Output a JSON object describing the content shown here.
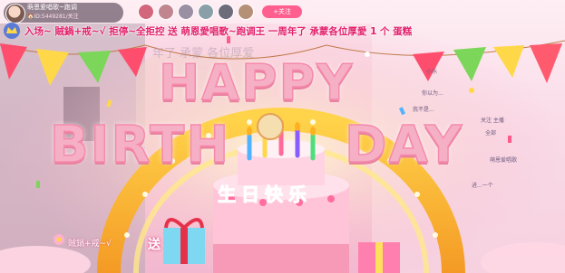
{
  "host": {
    "name": "萌恩爱唱歌~跑调",
    "id_line": "🏠ID:5449281/关注"
  },
  "follow_label": "+关注",
  "marquee": {
    "text": "入场~ 賊鍋+戒~√ 拒停~全拒控 送 萌恩愛唱歌~跑调王 一周年了 承蒙各位厚愛 1 个 蛋糕"
  },
  "ghost_text": "年了 承蒙 各位厚爱",
  "headline": {
    "happy": "HAPPY",
    "birth": "BIRTH",
    "day": "DAY"
  },
  "cake_text": "生日快乐",
  "gift_bar": {
    "user": "賊鍋+戒~√",
    "verb": "送"
  },
  "chat": [
    "小乐",
    "你以为...",
    "我不是...",
    "关注 主播",
    "全部",
    "萌恩爱唱歌",
    "进...一个"
  ]
}
